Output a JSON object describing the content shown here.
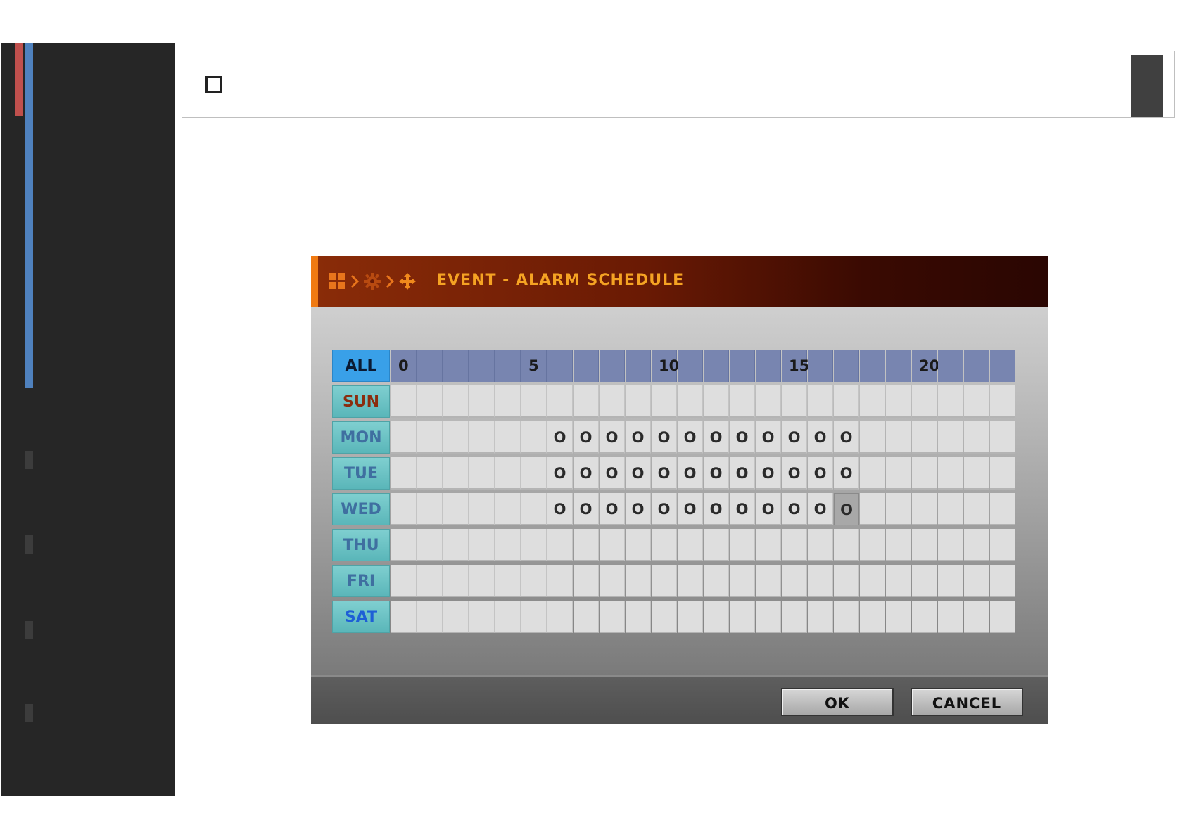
{
  "dialog": {
    "title": "EVENT - ALARM SCHEDULE",
    "icons": [
      "grid-icon",
      "chevron-right-icon",
      "gear-icon",
      "chevron-right-icon",
      "move-icon"
    ],
    "colors": {
      "title_text": "#f5a323",
      "title_accent": "#f07a12"
    }
  },
  "schedule": {
    "all_label": "ALL",
    "hour_labels": [
      "0",
      "",
      "",
      "",
      "",
      "5",
      "",
      "",
      "",
      "",
      "10",
      "",
      "",
      "",
      "",
      "15",
      "",
      "",
      "",
      "",
      "20",
      "",
      "",
      ""
    ],
    "days": [
      {
        "label": "SUN",
        "color": "#8b2d0e",
        "cells": [
          "",
          "",
          "",
          "",
          "",
          "",
          "",
          "",
          "",
          "",
          "",
          "",
          "",
          "",
          "",
          "",
          "",
          "",
          "",
          "",
          "",
          "",
          "",
          ""
        ]
      },
      {
        "label": "MON",
        "color": "#3f6fa0",
        "cells": [
          "",
          "",
          "",
          "",
          "",
          "",
          "O",
          "O",
          "O",
          "O",
          "O",
          "O",
          "O",
          "O",
          "O",
          "O",
          "O",
          "O",
          "",
          "",
          "",
          "",
          "",
          ""
        ]
      },
      {
        "label": "TUE",
        "color": "#3f6fa0",
        "cells": [
          "",
          "",
          "",
          "",
          "",
          "",
          "O",
          "O",
          "O",
          "O",
          "O",
          "O",
          "O",
          "O",
          "O",
          "O",
          "O",
          "O",
          "",
          "",
          "",
          "",
          "",
          ""
        ]
      },
      {
        "label": "WED",
        "color": "#3f6fa0",
        "cells": [
          "",
          "",
          "",
          "",
          "",
          "",
          "O",
          "O",
          "O",
          "O",
          "O",
          "O",
          "O",
          "O",
          "O",
          "O",
          "O",
          "O",
          "",
          "",
          "",
          "",
          "",
          ""
        ],
        "selected_hour": 17
      },
      {
        "label": "THU",
        "color": "#3f6fa0",
        "cells": [
          "",
          "",
          "",
          "",
          "",
          "",
          "",
          "",
          "",
          "",
          "",
          "",
          "",
          "",
          "",
          "",
          "",
          "",
          "",
          "",
          "",
          "",
          "",
          ""
        ]
      },
      {
        "label": "FRI",
        "color": "#3f6fa0",
        "cells": [
          "",
          "",
          "",
          "",
          "",
          "",
          "",
          "",
          "",
          "",
          "",
          "",
          "",
          "",
          "",
          "",
          "",
          "",
          "",
          "",
          "",
          "",
          "",
          ""
        ]
      },
      {
        "label": "SAT",
        "color": "#1e5fd6",
        "cells": [
          "",
          "",
          "",
          "",
          "",
          "",
          "",
          "",
          "",
          "",
          "",
          "",
          "",
          "",
          "",
          "",
          "",
          "",
          "",
          "",
          "",
          "",
          "",
          ""
        ]
      }
    ]
  },
  "buttons": {
    "ok": "OK",
    "cancel": "CANCEL"
  }
}
